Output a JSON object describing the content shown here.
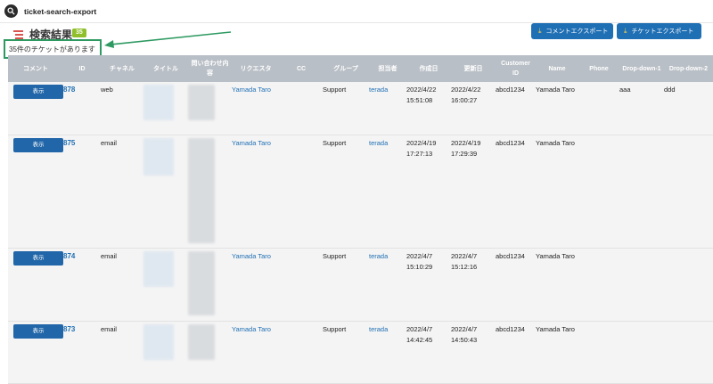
{
  "app": {
    "title": "ticket-search-export",
    "icon": "search-icon"
  },
  "header": {
    "title": "検索結果",
    "badge": "35",
    "count_text": "35件のチケットがあります",
    "export_comments_label": "コメントエクスポート",
    "export_tickets_label": "チケットエクスポート"
  },
  "columns": [
    "コメント",
    "ID",
    "チャネル",
    "タイトル",
    "問い合わせ内容",
    "リクエスタ",
    "CC",
    "グループ",
    "担当者",
    "作成日",
    "更新日",
    "Customer ID",
    "Name",
    "Phone",
    "Drop-down-1",
    "Drop-down-2"
  ],
  "view_label": "表示",
  "rows": [
    {
      "id": "878",
      "channel": "web",
      "requester": "Yamada Taro",
      "cc": "",
      "group": "Support",
      "assignee": "terada",
      "created": "2022/4/22 15:51:08",
      "updated": "2022/4/22 16:00:27",
      "customer_id": "abcd1234",
      "name": "Yamada Taro",
      "phone": "",
      "dd1": "aaa",
      "dd2": "ddd"
    },
    {
      "id": "875",
      "channel": "email",
      "requester": "Yamada Taro",
      "cc": "",
      "group": "Support",
      "assignee": "terada",
      "created": "2022/4/19 17:27:13",
      "updated": "2022/4/19 17:29:39",
      "customer_id": "abcd1234",
      "name": "Yamada Taro",
      "phone": "",
      "dd1": "",
      "dd2": ""
    },
    {
      "id": "874",
      "channel": "email",
      "requester": "Yamada Taro",
      "cc": "",
      "group": "Support",
      "assignee": "terada",
      "created": "2022/4/7 15:10:29",
      "updated": "2022/4/7 15:12:16",
      "customer_id": "abcd1234",
      "name": "Yamada Taro",
      "phone": "",
      "dd1": "",
      "dd2": ""
    },
    {
      "id": "873",
      "channel": "email",
      "requester": "Yamada Taro",
      "cc": "",
      "group": "Support",
      "assignee": "terada",
      "created": "2022/4/7 14:42:45",
      "updated": "2022/4/7 14:50:43",
      "customer_id": "abcd1234",
      "name": "Yamada Taro",
      "phone": "",
      "dd1": "",
      "dd2": ""
    }
  ],
  "colors": {
    "primary": "#1f6fb4",
    "header_bg": "#b9bfc6",
    "badge": "#8fbf2a",
    "highlight": "#2e9a61"
  }
}
